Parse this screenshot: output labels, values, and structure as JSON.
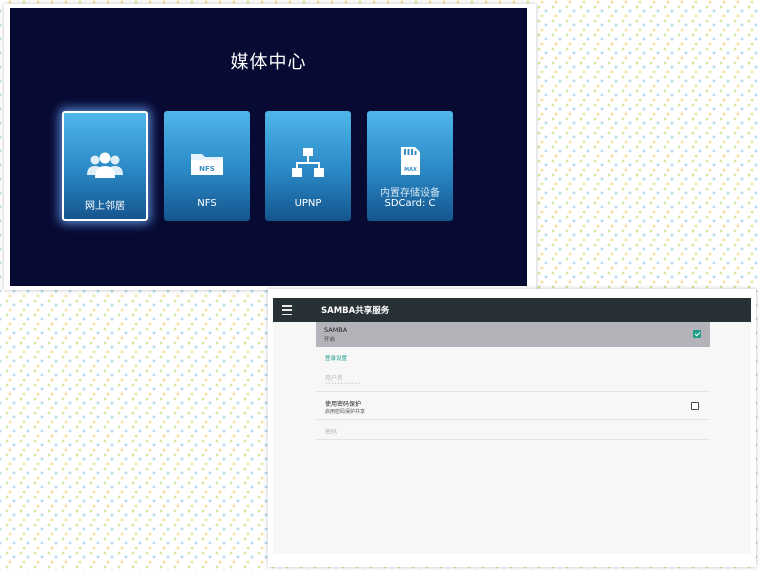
{
  "media_center": {
    "title": "媒体中心",
    "tiles": [
      {
        "icon": "users-group-icon",
        "label": "网上邻居",
        "selected": true
      },
      {
        "icon": "nfs-folder-icon",
        "icon_text": "NFS",
        "label": "NFS",
        "selected": false
      },
      {
        "icon": "network-tree-icon",
        "label": "UPNP",
        "selected": false
      },
      {
        "icon": "sd-card-icon",
        "icon_text": "MAX",
        "sub_label": "内置存储设备",
        "label": "SDCard: C",
        "selected": false
      }
    ],
    "colors": {
      "background": "#070a33",
      "tile_top": "#4fb6ea",
      "tile_bottom": "#15558e"
    }
  },
  "settings": {
    "appbar_title": "SAMBA共享服务",
    "samba": {
      "title": "SAMBA",
      "subtitle": "开启",
      "checked": true
    },
    "login_section": "登录设置",
    "username": {
      "label": "用户名",
      "placeholder": "••••••••••••"
    },
    "password_protect": {
      "title": "使用密码保护",
      "subtitle": "启用密码保护共享",
      "checked": false
    },
    "password": {
      "label": "密码"
    },
    "colors": {
      "appbar": "#283136",
      "accent": "#1f9e8c",
      "highlight_row": "#b3b3b9"
    }
  }
}
